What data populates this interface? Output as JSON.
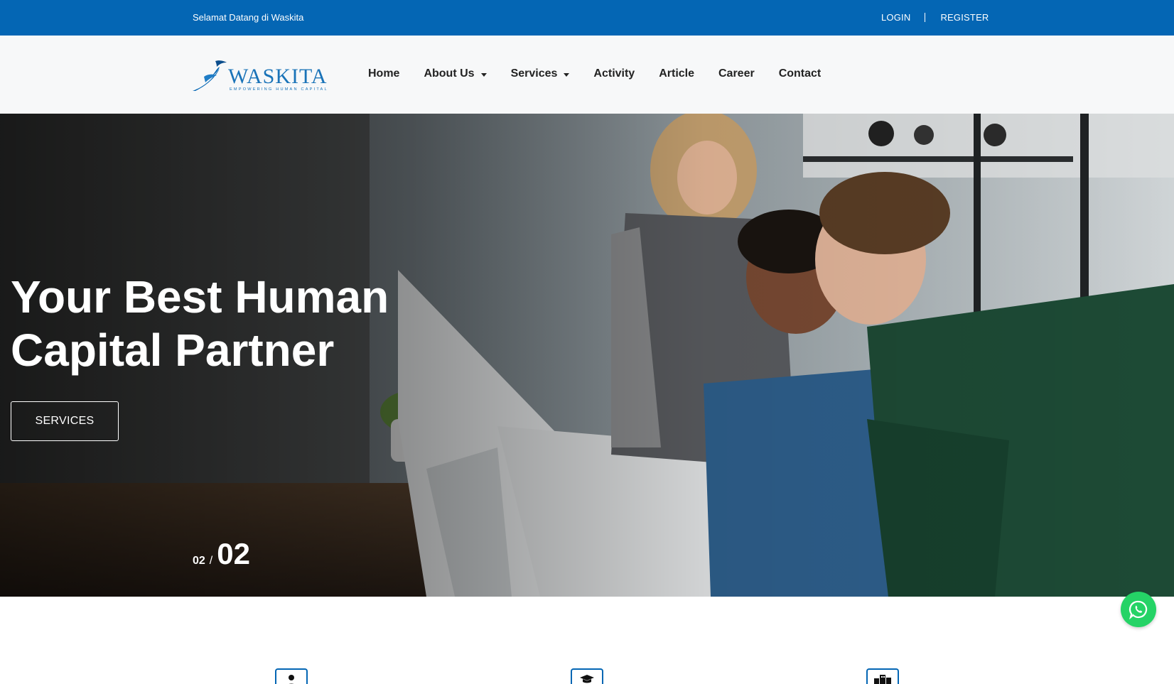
{
  "topbar": {
    "welcome": "Selamat Datang di Waskita",
    "login": "LOGIN",
    "register": "REGISTER"
  },
  "brand": {
    "name": "WASKITA",
    "tagline": "EMPOWERING HUMAN CAPITAL",
    "color": "#0466b4"
  },
  "nav": {
    "items": [
      {
        "label": "Home"
      },
      {
        "label": "About Us"
      },
      {
        "label": "Services"
      },
      {
        "label": "Activity"
      },
      {
        "label": "Article"
      },
      {
        "label": "Career"
      },
      {
        "label": "Contact"
      }
    ]
  },
  "hero": {
    "title_line1": "Your Best Human",
    "title_line2": "Capital Partner",
    "button": "SERVICES",
    "slide_current": "02",
    "slide_separator": "/",
    "slide_total": "02"
  },
  "features": {
    "icons": [
      "user-icon",
      "graduation-cap-icon",
      "building-icon"
    ]
  },
  "colors": {
    "topbar": "#0466b4",
    "whatsapp": "#25d366"
  }
}
